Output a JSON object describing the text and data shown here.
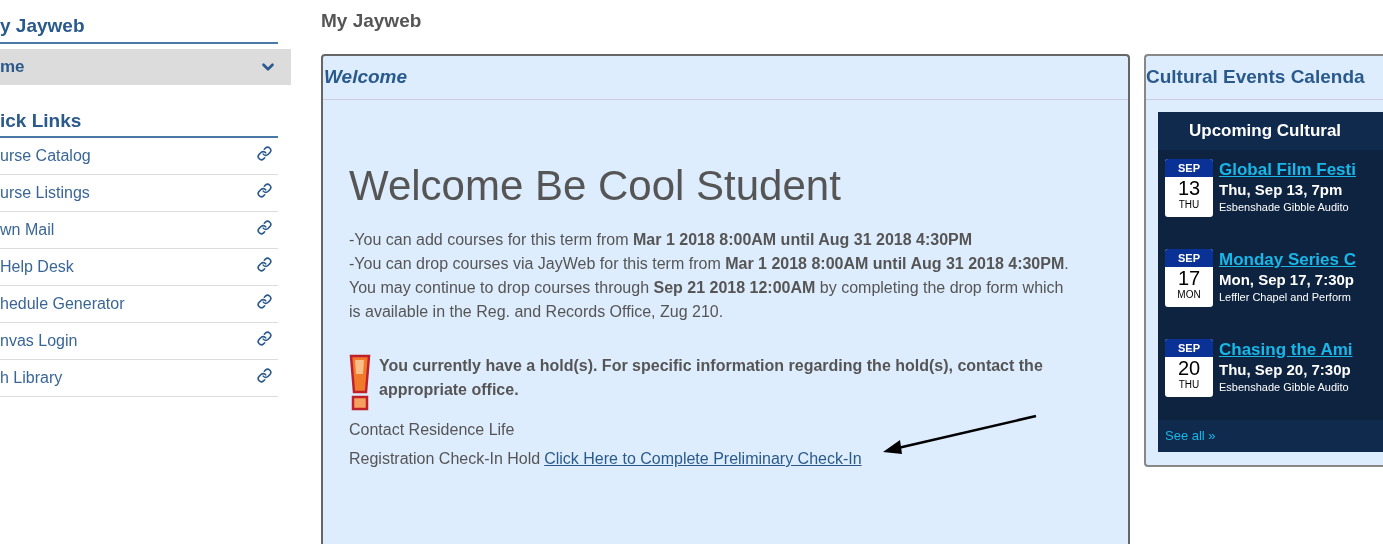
{
  "sidebar": {
    "title": "y Jayweb",
    "menu": {
      "label": "me",
      "expanded": true
    },
    "quick_links_title": "ick Links",
    "links": [
      {
        "label": "urse Catalog"
      },
      {
        "label": "urse Listings"
      },
      {
        "label": "wn Mail"
      },
      {
        "label": "Help Desk"
      },
      {
        "label": "hedule Generator"
      },
      {
        "label": "nvas Login"
      },
      {
        "label": "h Library"
      }
    ]
  },
  "page_title": "My Jayweb",
  "welcome": {
    "title": "Welcome",
    "heading": "Welcome Be Cool Student",
    "paragraphs": [
      "-You can add courses for this term from **Mar 1 2018 8:00AM until Aug 31 2018 4:30PM**",
      "-You can drop courses via JayWeb for this term from **Mar 1 2018 8:00AM until Aug 31 2018 4:30PM**. You may continue to drop courses through **Sep 21 2018 12:00AM** by completing the drop form which is available in the Reg. and Records Office, Zug 210."
    ],
    "hold_message": "You currently have a hold(s). For specific information regarding the hold(s), contact the appropriate office.",
    "holds": [
      {
        "text": "Contact Residence Life"
      },
      {
        "text": "Registration Check-In Hold",
        "link": "Click Here to Complete Preliminary Check-In"
      }
    ]
  },
  "calendar": {
    "title": "Cultural Events Calenda",
    "header": "Upcoming Cultural",
    "events": [
      {
        "month": "SEP",
        "day": "13",
        "weekday": "THU",
        "title": "Global Film Festi",
        "when": "Thu, Sep 13, 7pm",
        "where": "Esbenshade Gibble Audito"
      },
      {
        "month": "SEP",
        "day": "17",
        "weekday": "MON",
        "title": "Monday Series C",
        "when": "Mon, Sep 17, 7:30p",
        "where": "Leffler Chapel and Perform"
      },
      {
        "month": "SEP",
        "day": "20",
        "weekday": "THU",
        "title": "Chasing the Ami",
        "when": "Thu, Sep 20, 7:30p",
        "where": "Esbenshade Gibble Audito"
      }
    ],
    "see_all": "See all »"
  }
}
